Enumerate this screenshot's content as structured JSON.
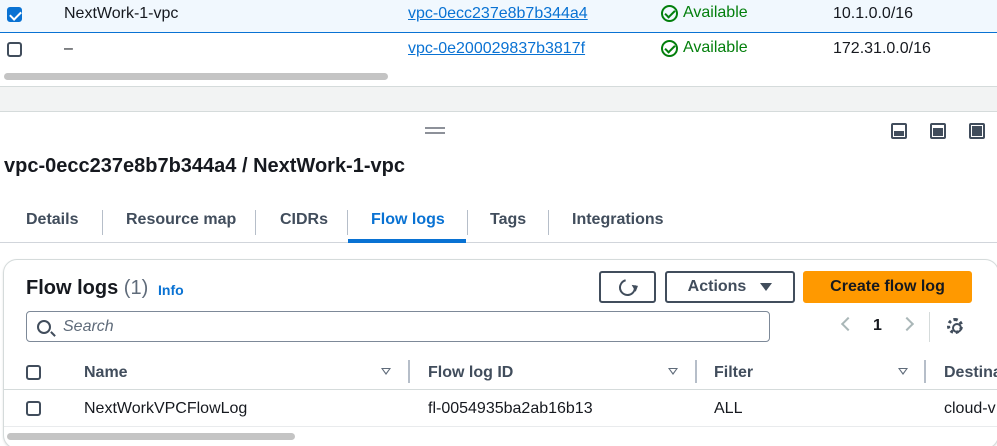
{
  "vpc_table": {
    "rows": [
      {
        "selected": true,
        "name": "NextWork-1-vpc",
        "vpc_id": "vpc-0ecc237e8b7b344a4",
        "state": "Available",
        "cidr": "10.1.0.0/16"
      },
      {
        "selected": false,
        "name": "–",
        "vpc_id": "vpc-0e200029837b3817f",
        "state": "Available",
        "cidr": "172.31.0.0/16"
      }
    ]
  },
  "detail": {
    "title": "vpc-0ecc237e8b7b344a4 / NextWork-1-vpc",
    "tabs": [
      {
        "label": "Details",
        "active": false
      },
      {
        "label": "Resource map",
        "active": false
      },
      {
        "label": "CIDRs",
        "active": false
      },
      {
        "label": "Flow logs",
        "active": true
      },
      {
        "label": "Tags",
        "active": false
      },
      {
        "label": "Integrations",
        "active": false
      }
    ]
  },
  "flow_logs": {
    "title": "Flow logs",
    "count": "(1)",
    "info_label": "Info",
    "actions_label": "Actions",
    "create_label": "Create flow log",
    "search_placeholder": "Search",
    "page": "1",
    "columns": [
      "Name",
      "Flow log ID",
      "Filter",
      "Destina"
    ],
    "rows": [
      {
        "name": "NextWorkVPCFlowLog",
        "id": "fl-0054935ba2ab16b13",
        "filter": "ALL",
        "destination": "cloud-v"
      }
    ]
  },
  "icons": {
    "refresh": "refresh-icon",
    "caret": "caret-down-icon",
    "search": "search-icon",
    "prev": "chevron-left-icon",
    "next": "chevron-right-icon",
    "settings": "gear-icon",
    "status": "check-circle-icon"
  },
  "colors": {
    "accent": "#0972d3",
    "success": "#037f0c",
    "primary_button": "#ff9900",
    "selected_row": "#f1f8fe"
  }
}
